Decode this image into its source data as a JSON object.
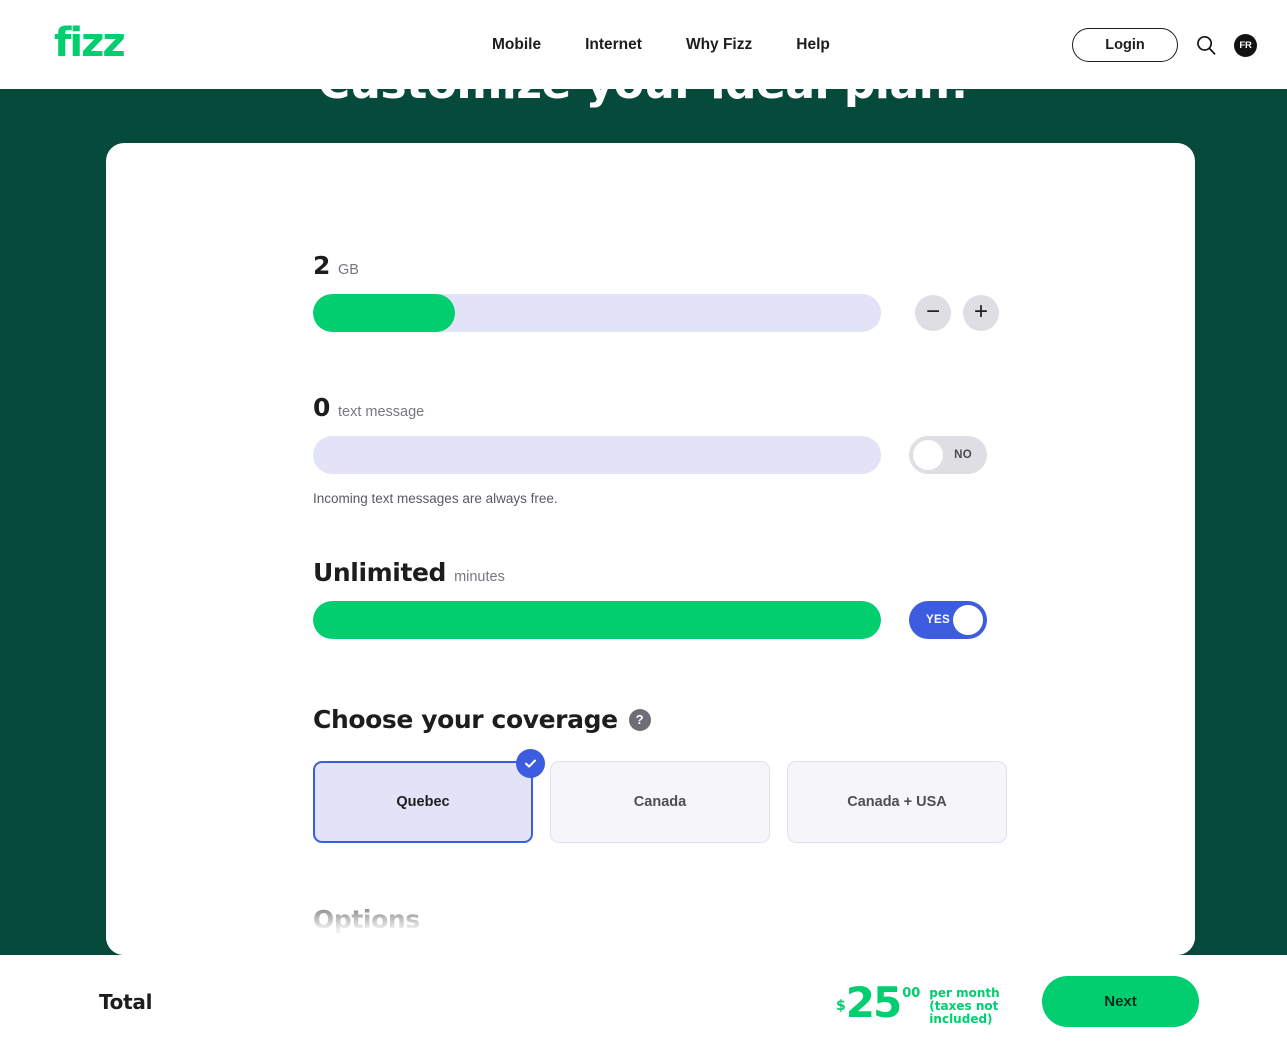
{
  "header": {
    "logo_text": "fizz",
    "nav": [
      {
        "label": "Mobile"
      },
      {
        "label": "Internet"
      },
      {
        "label": "Why Fizz"
      },
      {
        "label": "Help"
      }
    ],
    "login_label": "Login",
    "search_icon": "search-icon",
    "language_label": "FR"
  },
  "hero": {
    "title": "Customize your ideal plan!"
  },
  "plan": {
    "data": {
      "value": "2",
      "unit": "GB",
      "fill_percent": 25,
      "decrease_label": "−",
      "increase_label": "+"
    },
    "text": {
      "value": "0",
      "unit": "text message",
      "fill_percent": 0,
      "toggle_state": "NO",
      "toggle_on": false,
      "helper": "Incoming text messages are always free."
    },
    "minutes": {
      "value": "Unlimited",
      "unit": "minutes",
      "fill_percent": 100,
      "toggle_state": "YES",
      "toggle_on": true
    },
    "coverage": {
      "title": "Choose your coverage",
      "help_icon": "?",
      "options": [
        {
          "label": "Quebec",
          "selected": true
        },
        {
          "label": "Canada",
          "selected": false
        },
        {
          "label": "Canada + USA",
          "selected": false
        }
      ]
    },
    "options_heading": "Options"
  },
  "footer": {
    "total_label": "Total",
    "currency": "$",
    "amount": "25",
    "cents": "00",
    "note": "per month (taxes not included)",
    "next_label": "Next"
  },
  "colors": {
    "brand_green": "#00ce6f",
    "dark_teal": "#064a3c",
    "accent_blue": "#3d5ce0",
    "track_lavender": "#e2e3f7"
  }
}
